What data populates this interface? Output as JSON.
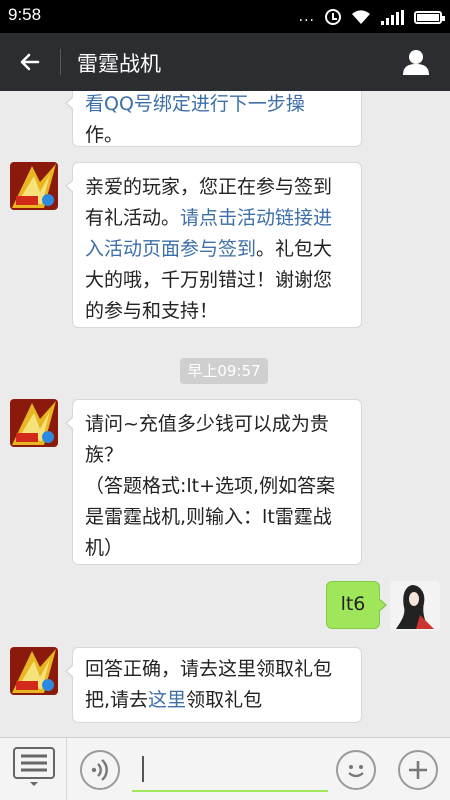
{
  "status_bar": {
    "time": "9:58",
    "dots": "..."
  },
  "header": {
    "title": "雷霆战机"
  },
  "messages": [
    {
      "sender": "game",
      "lines_before": [
        "看QQ号绑定进行下一步操",
        "作。"
      ]
    },
    {
      "sender": "game",
      "text_plain_1": "亲爱的玩家，您正在参与签到有礼活动。",
      "link": "请点击活动链接进入活动页面参与签到",
      "text_plain_2": "。礼包大大的哦，千万别错过！谢谢您的参与和支持！"
    },
    {
      "sender": "game",
      "lines": [
        "请问~充值多少钱可以成为贵族？",
        "（答题格式:lt+选项,例如答案是雷霆战机,则输入：lt雷霆战机）"
      ]
    },
    {
      "sender": "me",
      "text": "lt6"
    },
    {
      "sender": "game",
      "text_plain_1": "回答正确，请去这里领取礼包把,请去",
      "link": "这里",
      "text_plain_2": "领取礼包"
    }
  ],
  "timestamp": "早上09:57",
  "colors": {
    "header_bg": "#2b2d31",
    "link": "#3d6fa8",
    "my_bubble": "#9fe65a"
  }
}
